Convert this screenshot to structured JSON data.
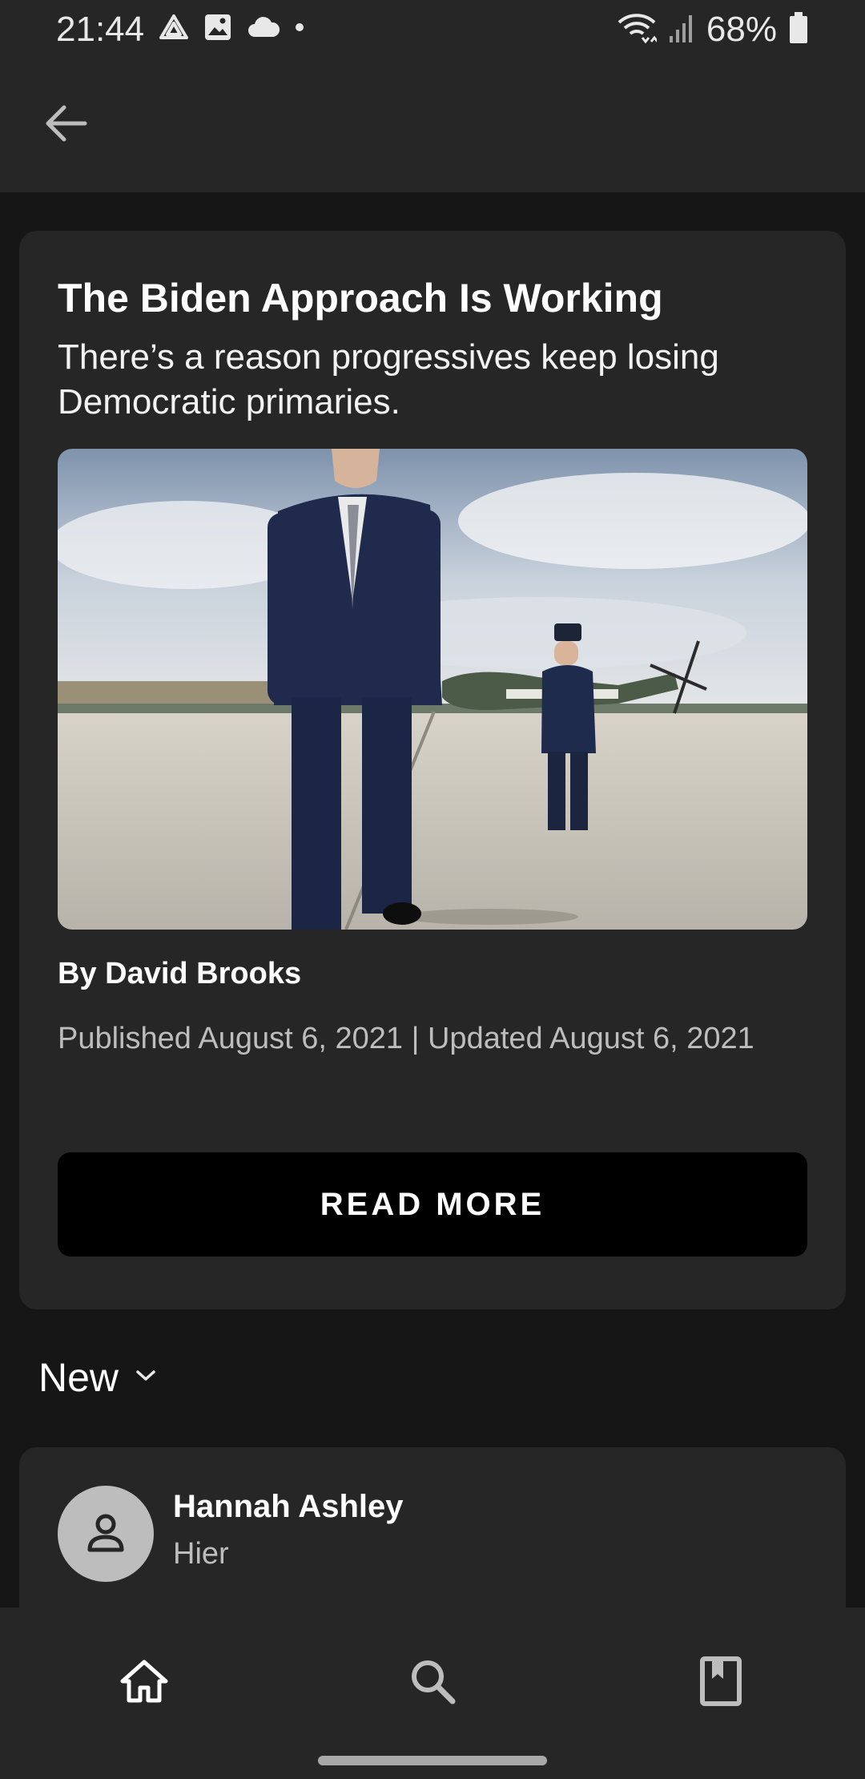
{
  "status_bar": {
    "time": "21:44",
    "battery": "68%",
    "icons": [
      "drive-icon",
      "image-icon",
      "cloud-icon",
      "dot-icon",
      "wifi-icon",
      "signal-icon",
      "battery-icon"
    ]
  },
  "header": {
    "back_icon": "arrow-left-icon"
  },
  "article": {
    "title": "The Biden Approach Is Working",
    "subtitle": "There’s a reason progressives keep losing Democratic primaries.",
    "byline": "By David Brooks",
    "dates": "Published August 6, 2021 | Updated August 6, 2021",
    "read_more_label": "READ MORE"
  },
  "comments": {
    "sort_label": "New",
    "sort_icon": "chevron-down-icon",
    "items": [
      {
        "author": "Hannah Ashley",
        "time": "Hier"
      }
    ]
  },
  "bottom_nav": {
    "items": [
      {
        "icon": "home-icon",
        "active": true
      },
      {
        "icon": "search-icon",
        "active": false
      },
      {
        "icon": "bookmark-icon",
        "active": false
      }
    ]
  },
  "colors": {
    "background": "#161616",
    "surface": "#262626",
    "button": "#000000",
    "muted_text": "#bdbdbd"
  }
}
